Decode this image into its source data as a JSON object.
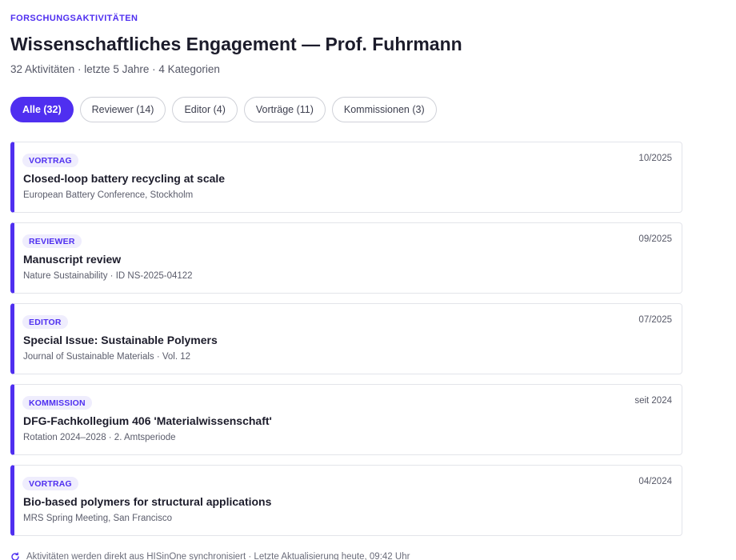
{
  "header": {
    "eyebrow": "FORSCHUNGSAKTIVITÄTEN",
    "title": "Wissenschaftliches Engagement — Prof. Fuhrmann",
    "subtitle": "32 Aktivitäten · letzte 5 Jahre · 4 Kategorien"
  },
  "filters": [
    {
      "label": "Alle (32)",
      "active": true
    },
    {
      "label": "Reviewer (14)",
      "active": false
    },
    {
      "label": "Editor (4)",
      "active": false
    },
    {
      "label": "Vorträge (11)",
      "active": false
    },
    {
      "label": "Kommissionen (3)",
      "active": false
    }
  ],
  "activities": [
    {
      "type": "VORTRAG",
      "date": "10/2025",
      "title": "Closed-loop battery recycling at scale",
      "meta": "European Battery Conference, Stockholm"
    },
    {
      "type": "REVIEWER",
      "date": "09/2025",
      "title": "Manuscript review",
      "meta": "Nature Sustainability · ID NS-2025-04122"
    },
    {
      "type": "EDITOR",
      "date": "07/2025",
      "title": "Special Issue: Sustainable Polymers",
      "meta": "Journal of Sustainable Materials · Vol. 12"
    },
    {
      "type": "KOMMISSION",
      "date": "seit 2024",
      "title": "DFG-Fachkollegium 406 'Materialwissenschaft'",
      "meta": "Rotation 2024–2028 · 2. Amtsperiode"
    },
    {
      "type": "VORTRAG",
      "date": "04/2024",
      "title": "Bio-based polymers for structural applications",
      "meta": "MRS Spring Meeting, San Francisco"
    }
  ],
  "footer": {
    "icon": "sync-icon",
    "text": "Aktivitäten werden direkt aus HISinOne synchronisiert · Letzte Aktualisierung heute, 09:42 Uhr"
  },
  "colors": {
    "accent": "#4f2ff0",
    "badge_bg": "#efedfd"
  }
}
